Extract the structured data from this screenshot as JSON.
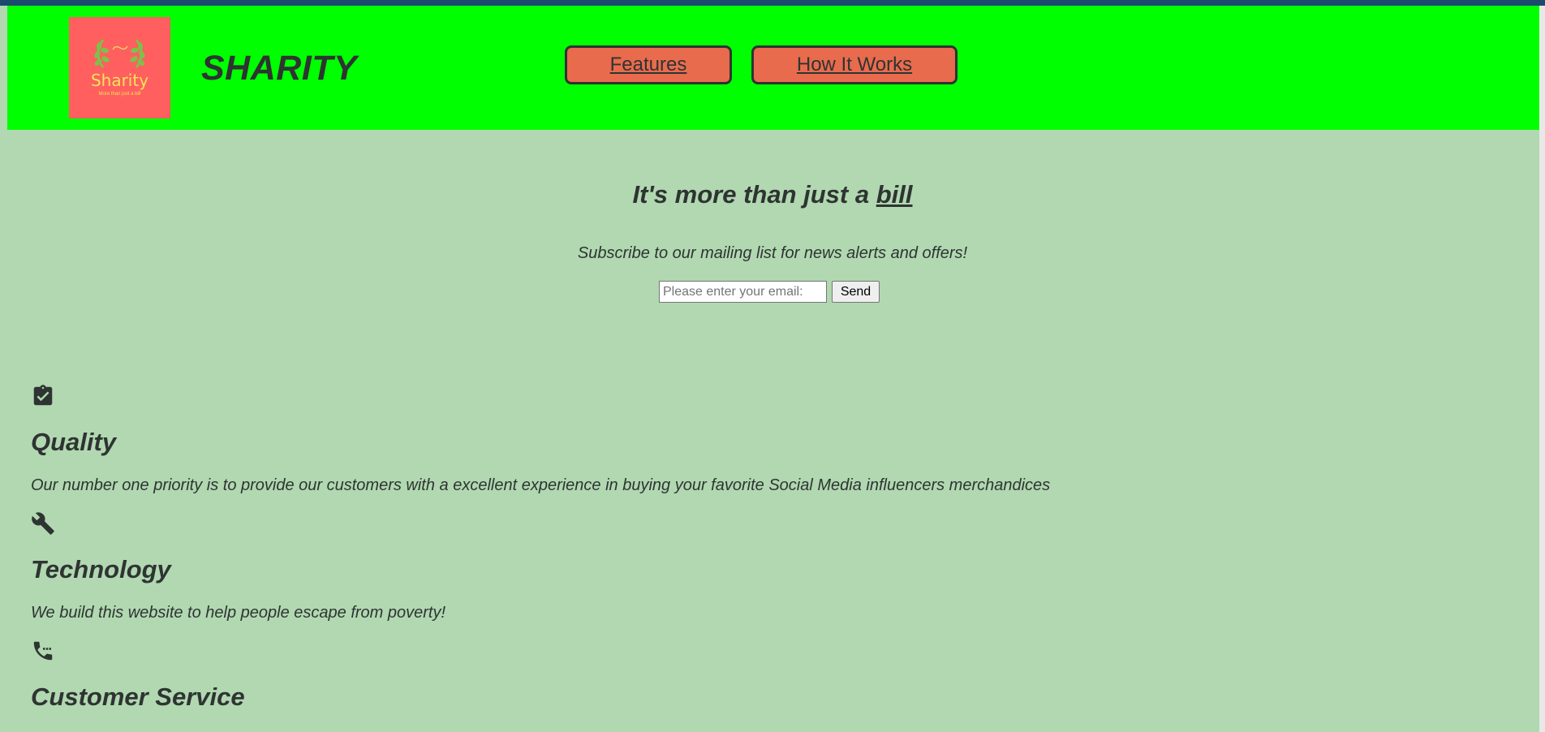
{
  "brand": {
    "logo_text": "Sharity",
    "logo_tagline": "More than just a bill",
    "name": "SHARITY"
  },
  "nav": {
    "items": [
      {
        "label": "Features"
      },
      {
        "label": "How It Works"
      }
    ]
  },
  "hero": {
    "title_prefix": "It's more than just a ",
    "title_emphasis": "bill",
    "subscribe_text": "Subscribe to our mailing list for news alerts and offers!",
    "email_placeholder": "Please enter your email:",
    "email_value": "",
    "send_label": "Send"
  },
  "features": [
    {
      "icon": "clipboard-check-icon",
      "title": "Quality",
      "description": "Our number one priority is to provide our customers with a excellent experience in buying your favorite Social Media influencers merchandices"
    },
    {
      "icon": "wrench-icon",
      "title": "Technology",
      "description": "We build this website to help people escape from poverty!"
    },
    {
      "icon": "phone-icon",
      "title": "Customer Service",
      "description": ""
    }
  ],
  "colors": {
    "header_bg": "#00ff00",
    "page_bg": "#b1d8b1",
    "button_bg": "#e86b4d",
    "logo_bg": "#ff5f5f",
    "text": "#2e3432"
  }
}
